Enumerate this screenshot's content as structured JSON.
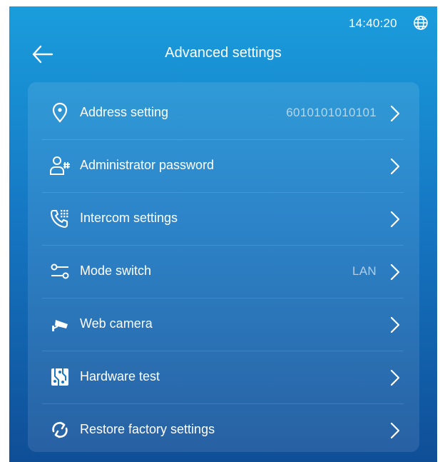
{
  "status": {
    "time": "14:40:20",
    "globe_icon": "globe-icon"
  },
  "header": {
    "title": "Advanced settings",
    "back_icon": "back-arrow-icon"
  },
  "colors": {
    "bg_top": "#1a9ddc",
    "bg_bottom": "#0f4e97",
    "text": "#ffffff"
  },
  "menu": {
    "items": [
      {
        "label": "Address setting",
        "value": "6010101010101",
        "icon": "location-pin-icon"
      },
      {
        "label": "Administrator password",
        "value": "",
        "icon": "user-key-icon"
      },
      {
        "label": "Intercom settings",
        "value": "",
        "icon": "phone-keypad-icon"
      },
      {
        "label": "Mode switch",
        "value": "LAN",
        "icon": "toggle-switch-icon"
      },
      {
        "label": "Web camera",
        "value": "",
        "icon": "camera-icon"
      },
      {
        "label": "Hardware test",
        "value": "",
        "icon": "circuit-board-icon"
      },
      {
        "label": "Restore factory settings",
        "value": "",
        "icon": "refresh-icon"
      }
    ]
  }
}
